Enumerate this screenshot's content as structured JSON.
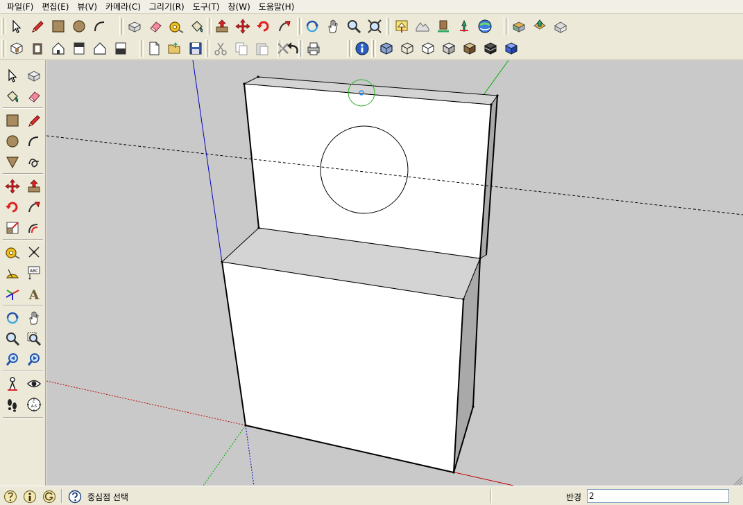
{
  "menu": [
    "파일(F)",
    "편집(E)",
    "뷰(V)",
    "카메라(C)",
    "그리기(R)",
    "도구(T)",
    "창(W)",
    "도움말(H)"
  ],
  "toolbar1_groups": [
    [
      "select-icon",
      "pencil-icon",
      "rectangle-icon",
      "circle-icon",
      "arc-icon"
    ],
    [
      "make-component-icon",
      "eraser-icon",
      "tape-measure-icon",
      "paint-bucket-icon"
    ],
    [
      "push-pull-icon",
      "move-icon",
      "rotate-icon",
      "follow-me-icon"
    ],
    [
      "orbit-icon",
      "pan-icon",
      "zoom-icon",
      "zoom-extents-icon"
    ],
    [
      "add-location-icon",
      "toggle-terrain-icon",
      "place-model-icon",
      "get-models-icon",
      "google-earth-icon"
    ],
    [
      "get-component-icon",
      "share-model-icon",
      "share-component-icon"
    ]
  ],
  "toolbar2_groups": [
    [
      "iso-view-icon",
      "top-view-icon",
      "front-view-icon",
      "right-view-icon",
      "back-view-icon",
      "left-view-icon"
    ],
    [
      "new-file-icon",
      "open-file-icon",
      "save-file-icon"
    ],
    [
      "cut-icon",
      "copy-icon",
      "paste-icon",
      "delete-icon"
    ],
    [
      "undo-icon",
      "redo-icon"
    ],
    [
      "print-icon"
    ],
    [
      "model-info-icon"
    ],
    [
      "xray-style-icon",
      "wireframe-style-icon",
      "hidden-line-style-icon",
      "shaded-style-icon",
      "shaded-texture-style-icon",
      "monochrome-style-icon",
      "unknown-style-icon"
    ]
  ],
  "left_toolbar_rows": [
    [
      "select-icon",
      "make-component-icon"
    ],
    [
      "paint-bucket-icon",
      "eraser-icon"
    ],
    [
      "rectangle-icon",
      "line-icon"
    ],
    [
      "circle-icon",
      "arc-icon"
    ],
    [
      "polygon-icon",
      "freehand-icon"
    ],
    [
      "move-icon",
      "push-pull-icon"
    ],
    [
      "rotate-icon",
      "follow-me-icon"
    ],
    [
      "scale-icon",
      "offset-icon"
    ],
    [
      "tape-measure-icon",
      "dimensions-icon"
    ],
    [
      "protractor-icon",
      "text-icon"
    ],
    [
      "axes-icon",
      "3d-text-icon"
    ],
    [
      "orbit-icon",
      "pan-icon"
    ],
    [
      "zoom-icon",
      "zoom-window-icon"
    ],
    [
      "previous-view-icon",
      "next-view-icon"
    ],
    [
      "position-camera-icon",
      "look-around-icon"
    ],
    [
      "walk-icon",
      "section-plane-icon"
    ]
  ],
  "text_icon_label": "ABC",
  "section_icon_label": "C\nA-5",
  "status": {
    "message": "중심점 선택",
    "vcb_label": "반경",
    "vcb_value": "2"
  },
  "colors": {
    "viewport_bg": "#c9c9c9",
    "face_white": "#ffffff",
    "face_gray": "#d8d8d8",
    "axis_red": "#c00000",
    "axis_green": "#00b000",
    "axis_blue": "#0000c0",
    "cursor_green": "#2bb32b",
    "cursor_blue": "#1e90ff"
  }
}
